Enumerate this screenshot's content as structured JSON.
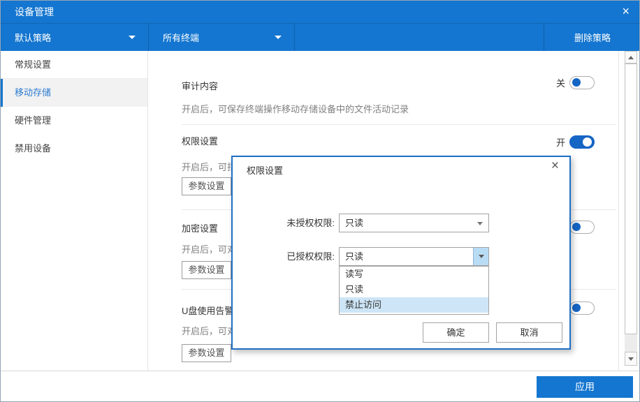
{
  "window": {
    "title": "设备管理"
  },
  "icons": {
    "close": "×",
    "modal_close": "×"
  },
  "policy_bar": {
    "policy_select": "默认策略",
    "terminal_select": "所有终端",
    "delete_button": "删除策略"
  },
  "sidebar": {
    "items": [
      {
        "label": "常规设置"
      },
      {
        "label": "移动存储"
      },
      {
        "label": "硬件管理"
      },
      {
        "label": "禁用设备"
      }
    ]
  },
  "sections": {
    "audit": {
      "title": "审计内容",
      "description": "开启后，可保存终端操作移动存储设备中的文件活动记录",
      "toggle_label": "关"
    },
    "permission": {
      "title": "权限设置",
      "description": "开启后，可指",
      "toggle_label": "开",
      "param_button": "参数设置"
    },
    "encryption": {
      "title": "加密设置",
      "description": "开启后，可对",
      "param_button": "参数设置"
    },
    "usb_alert": {
      "title": "U盘使用告警",
      "description": "开启后，可对",
      "param_button": "参数设置"
    }
  },
  "modal": {
    "title": "权限设置",
    "unauth_label": "未授权权限:",
    "unauth_value": "只读",
    "auth_label": "已授权权限:",
    "auth_value": "只读",
    "options": [
      {
        "label": "读写"
      },
      {
        "label": "只读"
      },
      {
        "label": "禁止访问"
      }
    ],
    "ok_button": "确定",
    "cancel_button": "取消"
  },
  "footer": {
    "apply_button": "应用"
  },
  "colors": {
    "primary": "#1476d0",
    "toggle_on": "#1565c5",
    "modal_border": "#1e6fc5",
    "option_highlight": "#cde5f6"
  }
}
